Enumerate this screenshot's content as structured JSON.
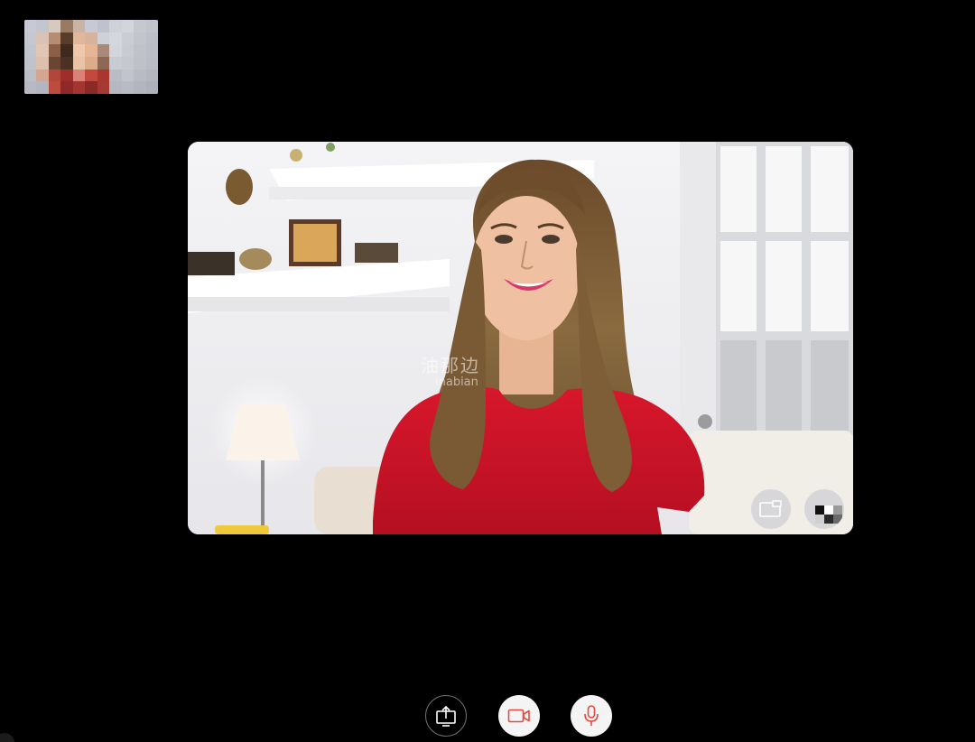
{
  "call": {
    "watermark_cn": "油那边",
    "watermark_en": "inabian"
  },
  "self_view": {
    "icon": "self-camera-preview"
  },
  "remote_view": {
    "controls": [
      {
        "id": "pip",
        "icon": "picture-in-picture-icon"
      },
      {
        "id": "avatar",
        "icon": "participant-avatar-icon"
      }
    ]
  },
  "toolbar": {
    "buttons": [
      {
        "id": "share",
        "icon": "screen-share-icon",
        "style": "outlined"
      },
      {
        "id": "camera",
        "icon": "video-camera-icon",
        "state": "off"
      },
      {
        "id": "mic",
        "icon": "microphone-icon",
        "state": "off"
      }
    ]
  },
  "colors": {
    "background": "#000000",
    "accent_red": "#e8483d",
    "button_light": "#f4f4f4",
    "button_outline": "#6f6f6f"
  }
}
